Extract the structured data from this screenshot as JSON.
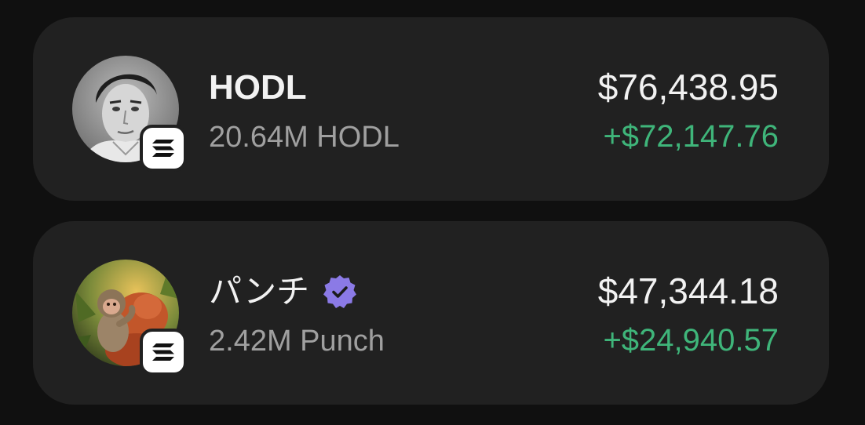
{
  "tokens": [
    {
      "name": "HODL",
      "holdings": "20.64M HODL",
      "value": "$76,438.95",
      "change": "+$72,147.76",
      "verified": false,
      "chain_icon": "solana-icon",
      "avatar_icon": "portrait-man-avatar"
    },
    {
      "name": "パンチ",
      "holdings": "2.42M Punch",
      "value": "$47,344.18",
      "change": "+$24,940.57",
      "verified": true,
      "chain_icon": "solana-icon",
      "avatar_icon": "monkey-avatar"
    }
  ],
  "colors": {
    "background": "#101010",
    "card": "#212121",
    "text_primary": "#f2f2f2",
    "text_secondary": "#a0a0a0",
    "positive": "#3fb57a",
    "verified_badge": "#8b7ae6"
  }
}
